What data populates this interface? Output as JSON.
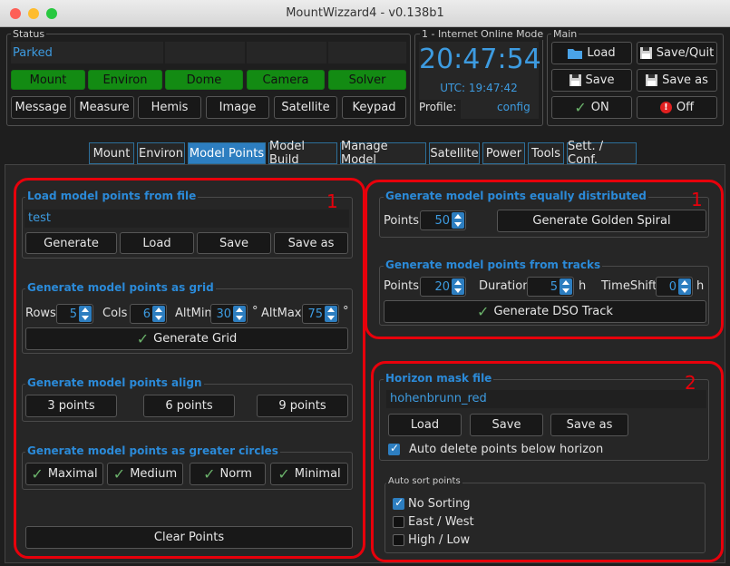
{
  "window": {
    "title": "MountWizzard4 - v0.138b1"
  },
  "status": {
    "label": "Status",
    "state": "Parked",
    "devices": [
      "Mount",
      "Environ",
      "Dome",
      "Camera",
      "Solver"
    ],
    "buttons": [
      "Message",
      "Measure",
      "Hemis",
      "Image",
      "Satellite",
      "Keypad"
    ]
  },
  "time": {
    "label": "1 - Internet Online Mode",
    "clock": "20:47:54",
    "utc": "UTC: 19:47:42",
    "profile_label": "Profile:",
    "profile_value": "config"
  },
  "main": {
    "label": "Main",
    "load": "Load",
    "save_quit": "Save/Quit",
    "save": "Save",
    "save_as": "Save as",
    "on": "ON",
    "off": "Off"
  },
  "tabs": [
    "Mount",
    "Environ",
    "Model Points",
    "Model Build",
    "Manage Model",
    "Satellite",
    "Power",
    "Tools",
    "Sett. / Conf."
  ],
  "left": {
    "load_file": {
      "title": "Load model points from file",
      "filename": "test",
      "buttons": [
        "Generate",
        "Load",
        "Save",
        "Save as"
      ]
    },
    "grid": {
      "title": "Generate model points as grid",
      "rows_label": "Rows",
      "rows": "5",
      "cols_label": "Cols",
      "cols": "6",
      "altmin_label": "AltMin",
      "altmin": "30",
      "altmax_label": "AltMax",
      "altmax": "75",
      "deg": "°",
      "button": "Generate Grid"
    },
    "align": {
      "title": "Generate model points align",
      "buttons": [
        "3 points",
        "6 points",
        "9 points"
      ]
    },
    "circles": {
      "title": "Generate model points as greater circles",
      "buttons": [
        "Maximal",
        "Medium",
        "Norm",
        "Minimal"
      ]
    },
    "clear": "Clear Points",
    "marker": "1"
  },
  "right": {
    "equal": {
      "title": "Generate model points equally distributed",
      "points_label": "Points",
      "points": "50",
      "button": "Generate Golden Spiral"
    },
    "tracks": {
      "title": "Generate model points from tracks",
      "points_label": "Points",
      "points": "20",
      "duration_label": "Duration",
      "duration": "5",
      "h": "h",
      "timeshift_label": "TimeShift",
      "timeshift": "0",
      "button": "Generate DSO Track"
    },
    "horizon": {
      "title": "Horizon mask file",
      "filename": "hohenbrunn_red",
      "buttons": [
        "Load",
        "Save",
        "Save as"
      ],
      "auto_delete": "Auto delete points below horizon"
    },
    "sort": {
      "title": "Auto sort points",
      "options": [
        "No Sorting",
        "East / West",
        "High / Low"
      ]
    },
    "marker1": "1",
    "marker2": "2"
  },
  "colors": {
    "accent": "#2d7ec0",
    "device_ok": "#138b13",
    "highlight": "#e8000b"
  }
}
